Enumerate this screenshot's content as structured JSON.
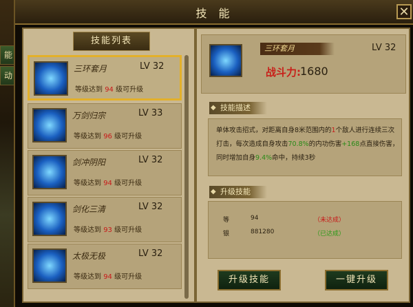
{
  "side_tabs": [
    "能",
    "动"
  ],
  "window": {
    "title": "技 能"
  },
  "skill_list": {
    "title": "技能列表",
    "items": [
      {
        "name": "三环套月",
        "level": "LV 32",
        "req_prefix": "等级达到",
        "req_level": "94",
        "req_suffix": "级可升级",
        "selected": true
      },
      {
        "name": "万剑归宗",
        "level": "LV 33",
        "req_prefix": "等级达到",
        "req_level": "96",
        "req_suffix": "级可升级",
        "selected": false
      },
      {
        "name": "剑冲阴阳",
        "level": "LV 32",
        "req_prefix": "等级达到",
        "req_level": "94",
        "req_suffix": "级可升级",
        "selected": false
      },
      {
        "name": "剑化三清",
        "level": "LV 32",
        "req_prefix": "等级达到",
        "req_level": "93",
        "req_suffix": "级可升级",
        "selected": false
      },
      {
        "name": "太极无极",
        "level": "LV 32",
        "req_prefix": "等级达到",
        "req_level": "94",
        "req_suffix": "级可升级",
        "selected": false
      }
    ]
  },
  "detail": {
    "name": "三环套月",
    "level": "LV 32",
    "power_label": "战斗力:",
    "power_value": "1680",
    "desc_title": "技能描述",
    "desc": {
      "p1": "单体攻击招式，对距离自身8米范围内的",
      "n1": "1",
      "p2": "个敌人进行连续三次打击，每次造成自身攻击",
      "n2": "70.8%",
      "p3": "的内功伤害",
      "n3": "+168",
      "p4": "点直接伤害，同时增加自身",
      "n4": "9.4%",
      "p5": "命中，持续3秒"
    },
    "upgrade_title": "升级技能",
    "upgrade": [
      {
        "label": "等",
        "value": "94",
        "status": "（未达成）",
        "status_color": "#c81818"
      },
      {
        "label": "银",
        "value": "881280",
        "status": "（已达成）",
        "status_color": "#2a9a18"
      }
    ]
  },
  "buttons": {
    "upgrade": "升级技能",
    "one_click": "一键升级"
  },
  "colors": {
    "accent_gold": "#e3b02a",
    "req_red": "#c81818",
    "hl_green": "#2a8a18"
  }
}
